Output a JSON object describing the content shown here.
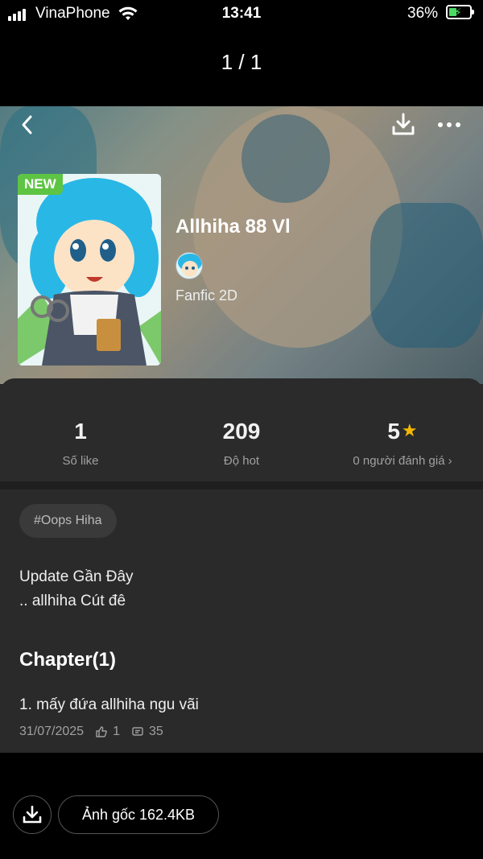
{
  "status_bar": {
    "carrier": "VinaPhone",
    "time": "13:41",
    "battery_percent": "36%",
    "battery_level": 0.36
  },
  "viewer": {
    "page_counter": "1 / 1"
  },
  "comic": {
    "badge": "NEW",
    "title": "Allhiha 88 Vl",
    "genre": "Fanfic 2D",
    "stats": {
      "likes": {
        "value": "1",
        "label": "Số like"
      },
      "hot": {
        "value": "209",
        "label": "Độ hot"
      },
      "rating": {
        "value": "5",
        "label": "0 người đánh giá",
        "chevron": "›"
      }
    },
    "tag": "#Oops Hiha",
    "update": {
      "title": "Update Gần Đây",
      "text": ".. allhiha Cút đê"
    },
    "chapters_heading": "Chapter(1)",
    "chapters": [
      {
        "title": "1. mấy đứa allhiha ngu vãi",
        "date": "31/07/2025",
        "likes": "1",
        "comments": "35"
      }
    ]
  },
  "bottom_bar": {
    "original_label": "Ảnh gốc 162.4KB"
  },
  "icons": {
    "back": "chevron-left-icon",
    "download": "download-icon",
    "more": "more-horizontal-icon",
    "star": "star-icon",
    "like": "thumbs-up-icon",
    "comment": "comment-icon"
  },
  "colors": {
    "background": "#000000",
    "panel": "#2b2b2b",
    "star": "#f5b800",
    "new_badge": "#5ec443",
    "battery": "#4cd964"
  }
}
